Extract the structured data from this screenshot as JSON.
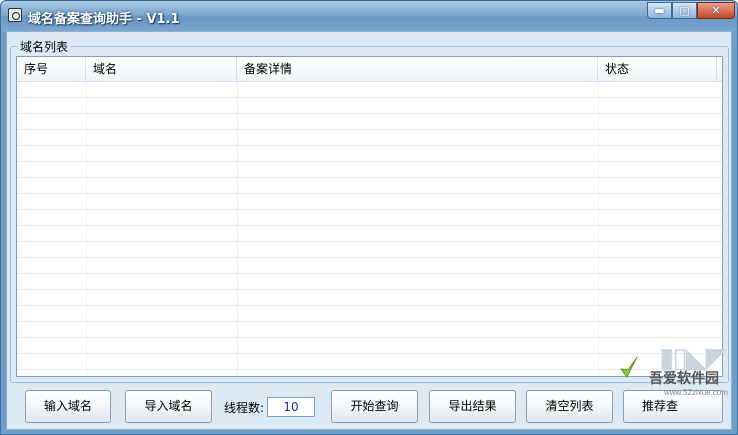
{
  "window": {
    "title": "域名备案查询助手 - V1.1",
    "controls": {
      "minimize": "▬",
      "maximize": "□",
      "close": "✕"
    }
  },
  "group": {
    "title": "域名列表"
  },
  "listview": {
    "columns": [
      "序号",
      "域名",
      "备案详情",
      "状态"
    ],
    "rows": []
  },
  "toolbar": {
    "input_domain": "输入域名",
    "import_domain": "导入域名",
    "thread_label": "线程数:",
    "thread_value": "10",
    "start_query": "开始查询",
    "export_results": "导出结果",
    "clear_list": "清空列表",
    "partial_button": "推荐查"
  },
  "watermark": {
    "brand": "吾爱软件园",
    "url": "www.52zixue.com"
  },
  "colors": {
    "title_bar": "#7fa9d0",
    "client_bg": "#dbe9f5",
    "close_button": "#c7452a"
  },
  "icons": [
    "app-icon",
    "minimize-icon",
    "maximize-icon",
    "close-icon",
    "watermark-check-icon"
  ]
}
